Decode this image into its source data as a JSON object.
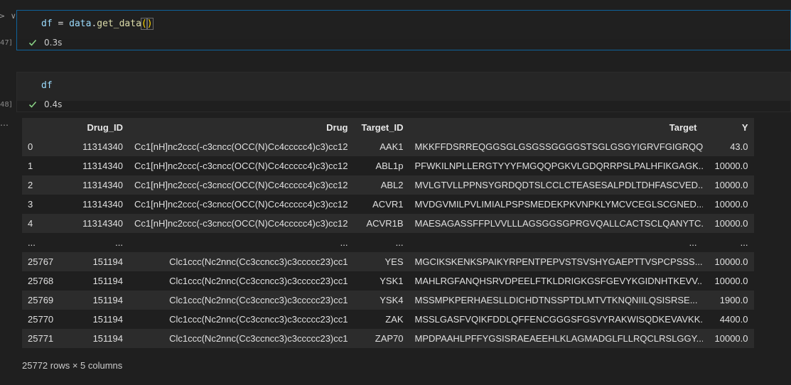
{
  "gutter": {
    "chevrons": "> ∨",
    "exec_count_1": "47]",
    "exec_count_2": "48]",
    "output_dots": "…"
  },
  "cell1": {
    "code": {
      "var": "df",
      "op": " = ",
      "obj": "data",
      "dot": ".",
      "fn": "get_data",
      "paren_open": "(",
      "paren_close": ")"
    },
    "status_icon": "check-icon",
    "time": "0.3s"
  },
  "cell2": {
    "code": "df",
    "status_icon": "check-icon",
    "time": "0.4s"
  },
  "table": {
    "columns": [
      "",
      "Drug_ID",
      "Drug",
      "Target_ID",
      "Target",
      "Y"
    ],
    "rows": [
      [
        "0",
        "11314340",
        "Cc1[nH]nc2ccc(-c3cncc(OCC(N)Cc4ccccc4)c3)cc12",
        "AAK1",
        "MKKFFDSRREQGGSGLGSGSSGGGGSTSGLGSGYIGRVFGIGRQQV...",
        "43.0"
      ],
      [
        "1",
        "11314340",
        "Cc1[nH]nc2ccc(-c3cncc(OCC(N)Cc4ccccc4)c3)cc12",
        "ABL1p",
        "PFWKILNPLLERGTYYYFMGQQPGKVLGDQRRPSLPALHFIKGAGK...",
        "10000.0"
      ],
      [
        "2",
        "11314340",
        "Cc1[nH]nc2ccc(-c3cncc(OCC(N)Cc4ccccc4)c3)cc12",
        "ABL2",
        "MVLGTVLLPPNSYGRDQDTSLCCLCTEASESALPDLTDHFASCVED...",
        "10000.0"
      ],
      [
        "3",
        "11314340",
        "Cc1[nH]nc2ccc(-c3cncc(OCC(N)Cc4ccccc4)c3)cc12",
        "ACVR1",
        "MVDGVMILPVLIMIALPSPSMEDEKPKVNPKLYMCVCEGLSCGNED...",
        "10000.0"
      ],
      [
        "4",
        "11314340",
        "Cc1[nH]nc2ccc(-c3cncc(OCC(N)Cc4ccccc4)c3)cc12",
        "ACVR1B",
        "MAESAGASSFFPLVVLLLAGSGGSGPRGVQALLCACTSCLQANYTC...",
        "10000.0"
      ],
      [
        "...",
        "...",
        "...",
        "...",
        "...",
        "..."
      ],
      [
        "25767",
        "151194",
        "Clc1ccc(Nc2nnc(Cc3ccncc3)c3ccccc23)cc1",
        "YES",
        "MGCIKSKENKSPAIKYRPENTPEPVSTSVSHYGAEPTTVSPCPSSS...",
        "10000.0"
      ],
      [
        "25768",
        "151194",
        "Clc1ccc(Nc2nnc(Cc3ccncc3)c3ccccc23)cc1",
        "YSK1",
        "MAHLRGFANQHSRVDPEELFTKLDRIGKGSFGEVYKGIDNHTKEVV...",
        "10000.0"
      ],
      [
        "25769",
        "151194",
        "Clc1ccc(Nc2nnc(Cc3ccncc3)c3ccccc23)cc1",
        "YSK4",
        "MSSMPKPERHAESLLDICHDTNSSPTDLMTVTKNQNIILQSISRSE...",
        "1900.0"
      ],
      [
        "25770",
        "151194",
        "Clc1ccc(Nc2nnc(Cc3ccncc3)c3ccccc23)cc1",
        "ZAK",
        "MSSLGASFVQIKFDDLQFFENCGGGSFGSVYRAKWISQDKEVAVKK...",
        "4400.0"
      ],
      [
        "25771",
        "151194",
        "Clc1ccc(Nc2nnc(Cc3ccncc3)c3ccccc23)cc1",
        "ZAP70",
        "MPDPAAHLPFFYGSISRAEAEEHLKLAGMADGLFLLRQCLRSLGGY...",
        "10000.0"
      ]
    ],
    "footer": "25772 rows × 5 columns"
  }
}
